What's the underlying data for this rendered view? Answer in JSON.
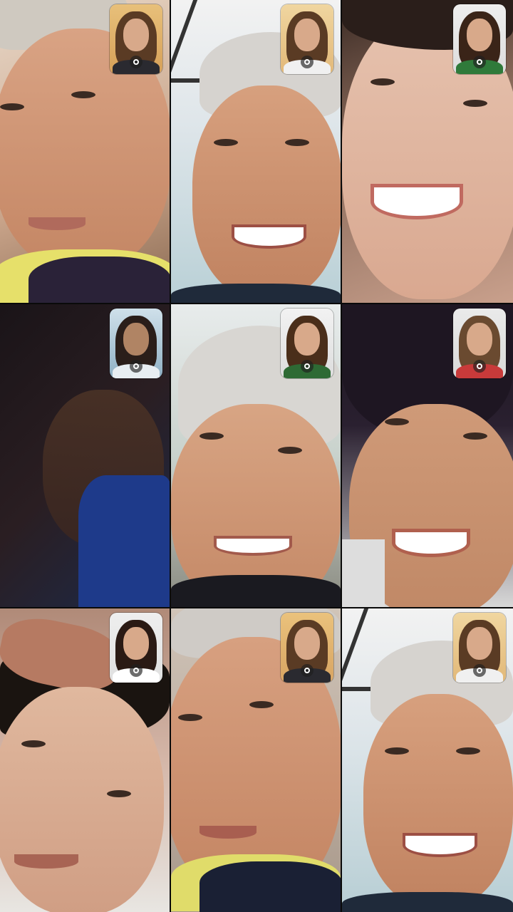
{
  "screen": {
    "type": "video-call-collage",
    "grid": "3x3",
    "background": "#111111"
  },
  "tiles": [
    {
      "id": 1,
      "scene": "man-cap-close",
      "self_view_camera": "camera-flip-icon"
    },
    {
      "id": 2,
      "scene": "man-cap-smiling-car",
      "self_view_camera": "camera-flip-icon"
    },
    {
      "id": 3,
      "scene": "man-laughing-close",
      "self_view_camera": "camera-flip-icon"
    },
    {
      "id": 4,
      "scene": "dark-dim-room",
      "self_view_camera": "camera-flip-icon"
    },
    {
      "id": 5,
      "scene": "man-cap-smiling-street",
      "self_view_camera": "camera-flip-icon"
    },
    {
      "id": 6,
      "scene": "man-smiling-lying",
      "self_view_camera": "camera-flip-icon"
    },
    {
      "id": 7,
      "scene": "man-lying-hand-on-head",
      "self_view_camera": "camera-flip-icon"
    },
    {
      "id": 8,
      "scene": "man-cap-close-yellow",
      "self_view_camera": "camera-flip-icon"
    },
    {
      "id": 9,
      "scene": "man-cap-smiling-car",
      "self_view_camera": "camera-flip-icon"
    }
  ]
}
